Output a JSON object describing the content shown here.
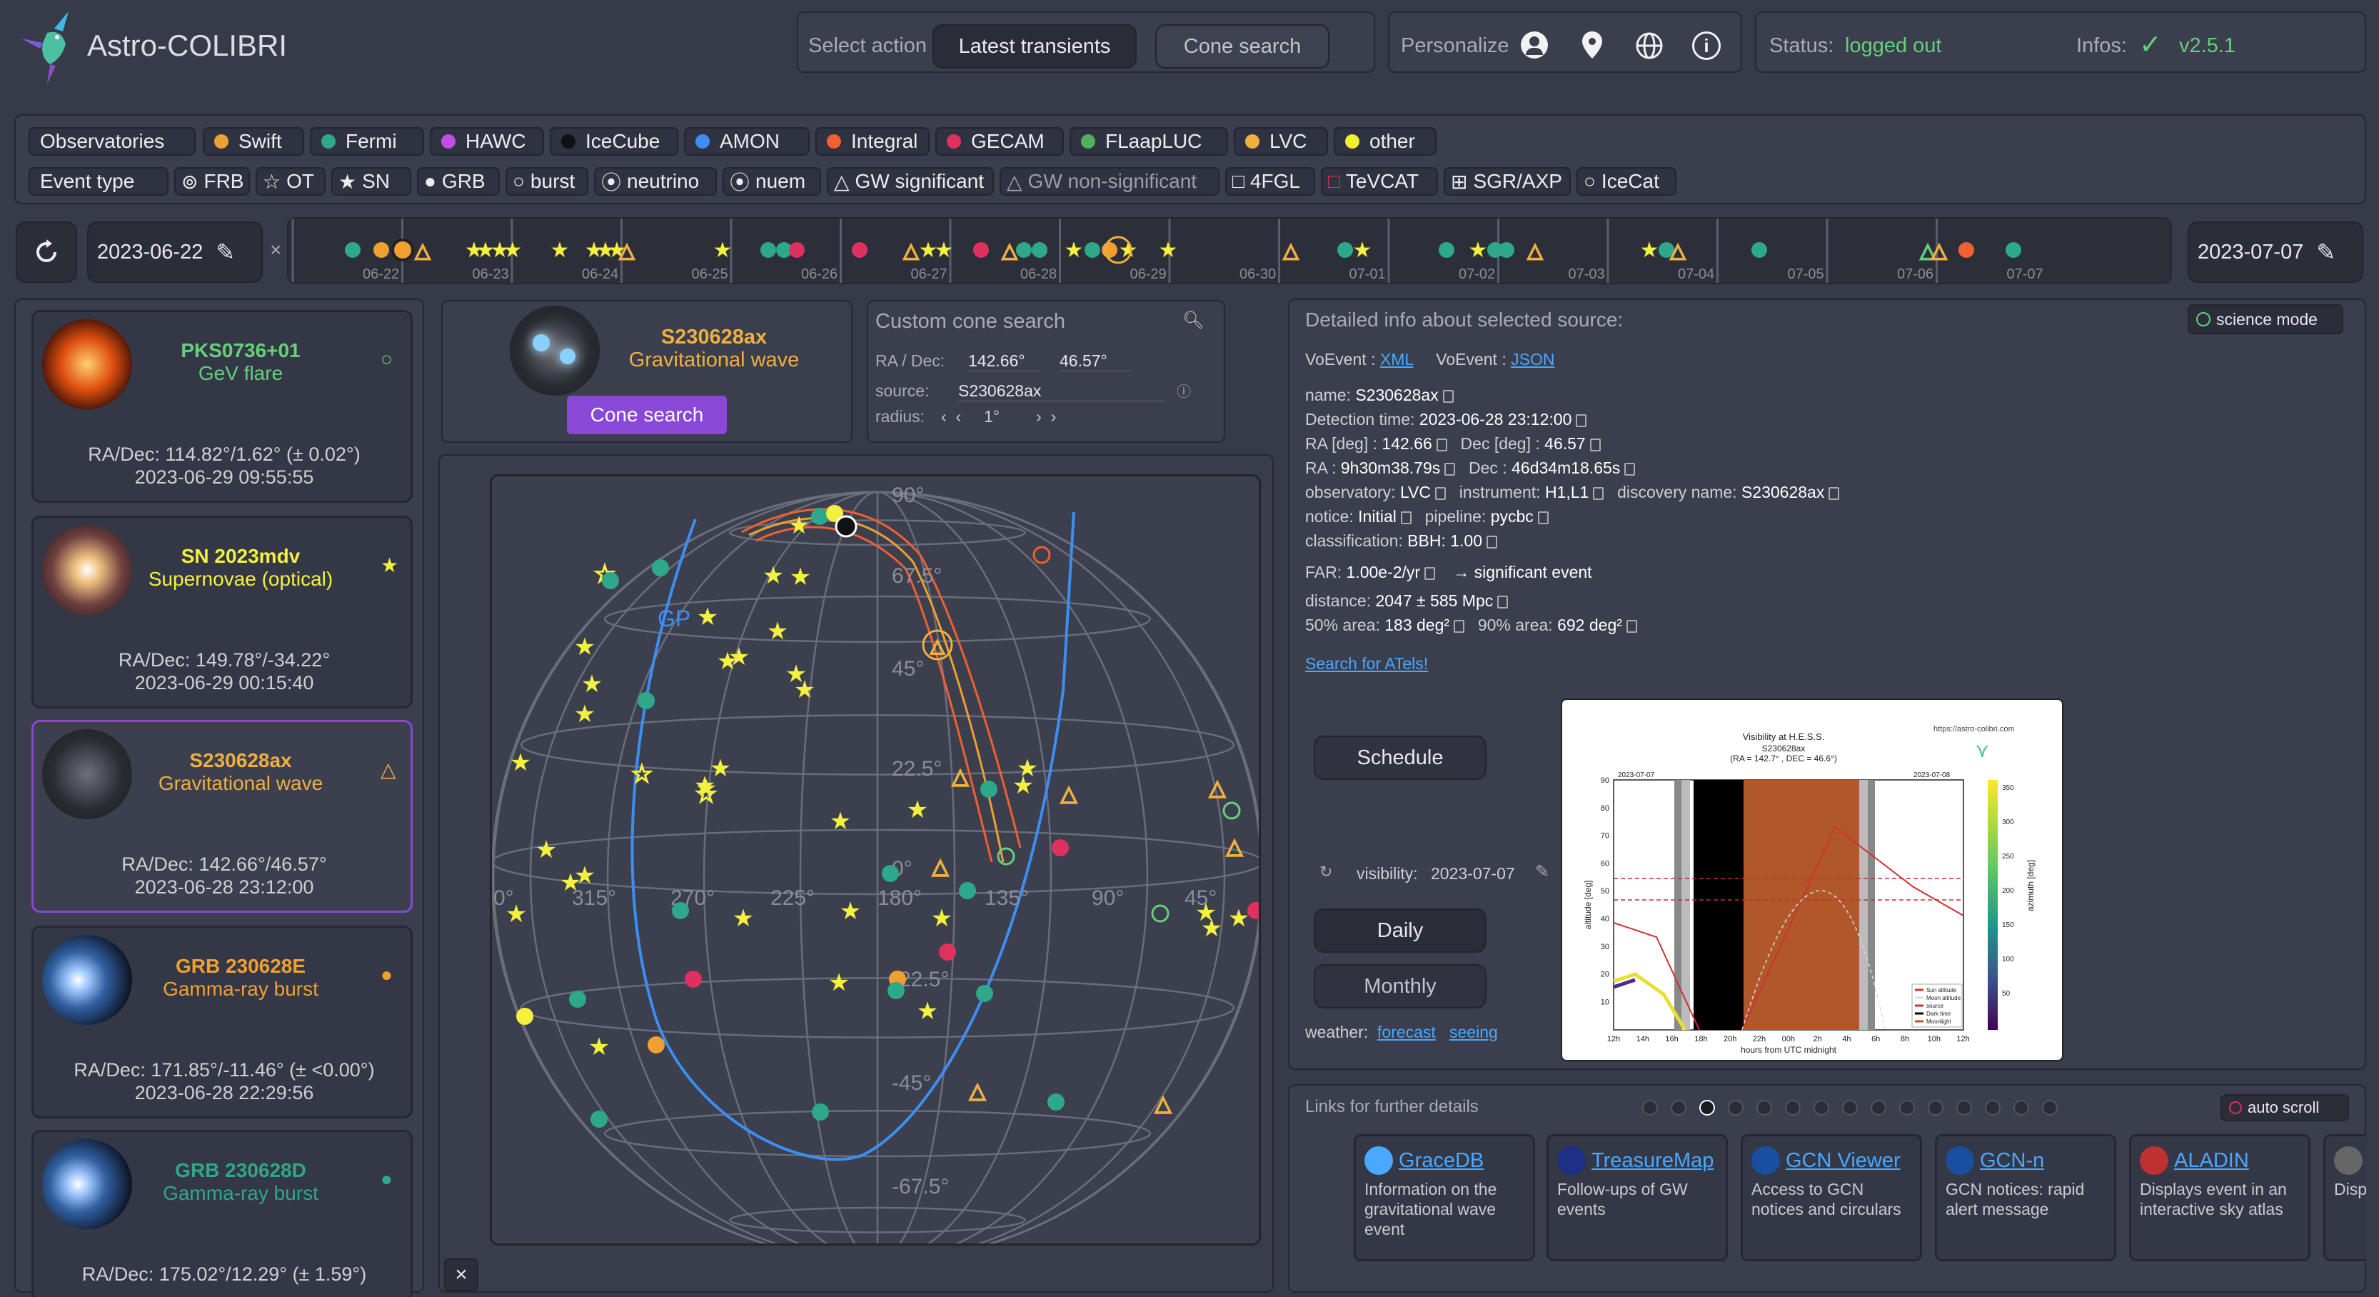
{
  "app": {
    "name": "Astro-COLIBRI"
  },
  "header": {
    "select_action": "Select action",
    "latest": "Latest transients",
    "cone": "Cone search",
    "personalize": "Personalize",
    "status_label": "Status:",
    "status_value": "logged out",
    "infos_label": "Infos:",
    "version": "v2.5.1"
  },
  "observatories": {
    "label": "Observatories",
    "items": [
      {
        "name": "Swift",
        "color": "#f0a030"
      },
      {
        "name": "Fermi",
        "color": "#2ea88a"
      },
      {
        "name": "HAWC",
        "color": "#c04ee0"
      },
      {
        "name": "IceCube",
        "color": "#111111"
      },
      {
        "name": "AMON",
        "color": "#3d8ef0"
      },
      {
        "name": "Integral",
        "color": "#f06030"
      },
      {
        "name": "GECAM",
        "color": "#e03060"
      },
      {
        "name": "FLaapLUC",
        "color": "#50b060"
      },
      {
        "name": "LVC",
        "color": "#f0b040"
      },
      {
        "name": "other",
        "color": "#f0f030"
      }
    ]
  },
  "event_types": {
    "label": "Event type",
    "items": [
      "FRB",
      "OT",
      "SN",
      "GRB",
      "burst",
      "neutrino",
      "nuem",
      "GW significant",
      "GW non-significant",
      "4FGL",
      "TeVCAT",
      "SGR/AXP",
      "IceCat"
    ]
  },
  "timeline": {
    "start": "2023-06-22",
    "end": "2023-07-07",
    "days": [
      "06-22",
      "06-23",
      "06-24",
      "06-25",
      "06-26",
      "06-27",
      "06-28",
      "06-29",
      "06-30",
      "07-01",
      "07-02",
      "07-03",
      "07-04",
      "07-05",
      "07-06",
      "07-07"
    ]
  },
  "cards": [
    {
      "name": "PKS0736+01",
      "type": "GeV flare",
      "coord": "RA/Dec: 114.82°/1.62°  (± 0.02°)",
      "time": "2023-06-29 09:55:55",
      "color": "#66d07a"
    },
    {
      "name": "SN 2023mdv",
      "type": "Supernovae (optical)",
      "coord": "RA/Dec: 149.78°/-34.22°",
      "time": "2023-06-29 00:15:40",
      "color": "#f4f040"
    },
    {
      "name": "S230628ax",
      "type": "Gravitational wave",
      "coord": "RA/Dec: 142.66°/46.57°",
      "time": "2023-06-28 23:12:00",
      "color": "#f0b040"
    },
    {
      "name": "GRB 230628E",
      "type": "Gamma-ray burst",
      "coord": "RA/Dec: 171.85°/-11.46°  (± <0.00°)",
      "time": "2023-06-28 22:29:56",
      "color": "#f0a030"
    },
    {
      "name": "GRB 230628D",
      "type": "Gamma-ray burst",
      "coord": "RA/Dec: 175.02°/12.29°  (± 1.59°)",
      "time": "",
      "color": "#2ea88a"
    }
  ],
  "selected": {
    "name": "S230628ax",
    "type": "Gravitational wave",
    "cone_button": "Cone search"
  },
  "custom_cone": {
    "title": "Custom cone search",
    "radec_label": "RA / Dec:",
    "ra": "142.66°",
    "dec": "46.57°",
    "source_label": "source:",
    "source": "S230628ax",
    "radius_label": "radius:",
    "radius": "1°"
  },
  "skymap": {
    "lat_labels": [
      "90°",
      "67.5°",
      "45°",
      "22.5°",
      "0°",
      "-22.5°",
      "-45°",
      "-67.5°"
    ],
    "lon_labels": [
      "0°",
      "315°",
      "270°",
      "225°",
      "180°",
      "135°",
      "90°",
      "45°"
    ],
    "gp": "GP"
  },
  "detail": {
    "title": "Detailed info about selected source:",
    "science_mode": "science mode",
    "voevent_label": "VoEvent :",
    "xml": "XML",
    "json": "JSON",
    "name": "S230628ax",
    "detection_time": "2023-06-28 23:12:00",
    "ra_deg": "142.66",
    "dec_deg": "46.57",
    "ra": "9h30m38.79s",
    "dec": "46d34m18.65s",
    "observatory": "LVC",
    "instrument": "H1,L1",
    "discovery_name": "S230628ax",
    "notice": "Initial",
    "pipeline": "pycbc",
    "classification": "BBH: 1.00",
    "far": "1.00e-2/yr",
    "far_note": "→ significant event",
    "distance": "2047 ± 585 Mpc",
    "area50": "183 deg²",
    "area90": "692 deg²",
    "atels": "Search for ATels!"
  },
  "visibility": {
    "schedule": "Schedule",
    "label": "visibility:",
    "date": "2023-07-07",
    "daily": "Daily",
    "monthly": "Monthly",
    "weather": "weather:",
    "forecast": "forecast",
    "seeing": "seeing",
    "plot_title": "Visibility at H.E.S.S.",
    "plot_sub": "S230628ax",
    "plot_coords": "(RA = 142.7° , DEC = 46.6°)",
    "url": "https://astro-colibri.com",
    "xlabel": "hours from UTC midnight",
    "ylabel": "altitude [deg]",
    "zlabel": "azimuth [deg]",
    "date_left": "2023-07-07",
    "date_right": "2023-07-08",
    "yticks": [
      "90",
      "80",
      "70",
      "60",
      "50",
      "40",
      "30",
      "20",
      "10"
    ],
    "xticks": [
      "12h",
      "14h",
      "16h",
      "18h",
      "20h",
      "22h",
      "00h",
      "2h",
      "4h",
      "6h",
      "8h",
      "10h",
      "12h"
    ],
    "cticks": [
      "350",
      "300",
      "250",
      "200",
      "150",
      "100",
      "50"
    ],
    "legend": [
      "Sun altitude",
      "Moon altitude",
      "source",
      "Dark time",
      "Moonlight"
    ]
  },
  "links": {
    "title": "Links for further details",
    "autoscroll": "auto scroll",
    "items": [
      {
        "name": "GraceDB",
        "desc": "Information on the gravitational wave event",
        "color": "#4aa8ff"
      },
      {
        "name": "TreasureMap",
        "desc": "Follow-ups of GW events",
        "color": "#1f2f88"
      },
      {
        "name": "GCN Viewer",
        "desc": "Access to GCN notices and circulars",
        "color": "#1a4fa0"
      },
      {
        "name": "GCN-n",
        "desc": "GCN notices: rapid alert message",
        "color": "#1a4fa0"
      },
      {
        "name": "ALADIN",
        "desc": "Displays event in an interactive sky atlas",
        "color": "#c03030"
      },
      {
        "name": "Displ",
        "desc": "Displ intera",
        "color": "#666"
      }
    ]
  }
}
